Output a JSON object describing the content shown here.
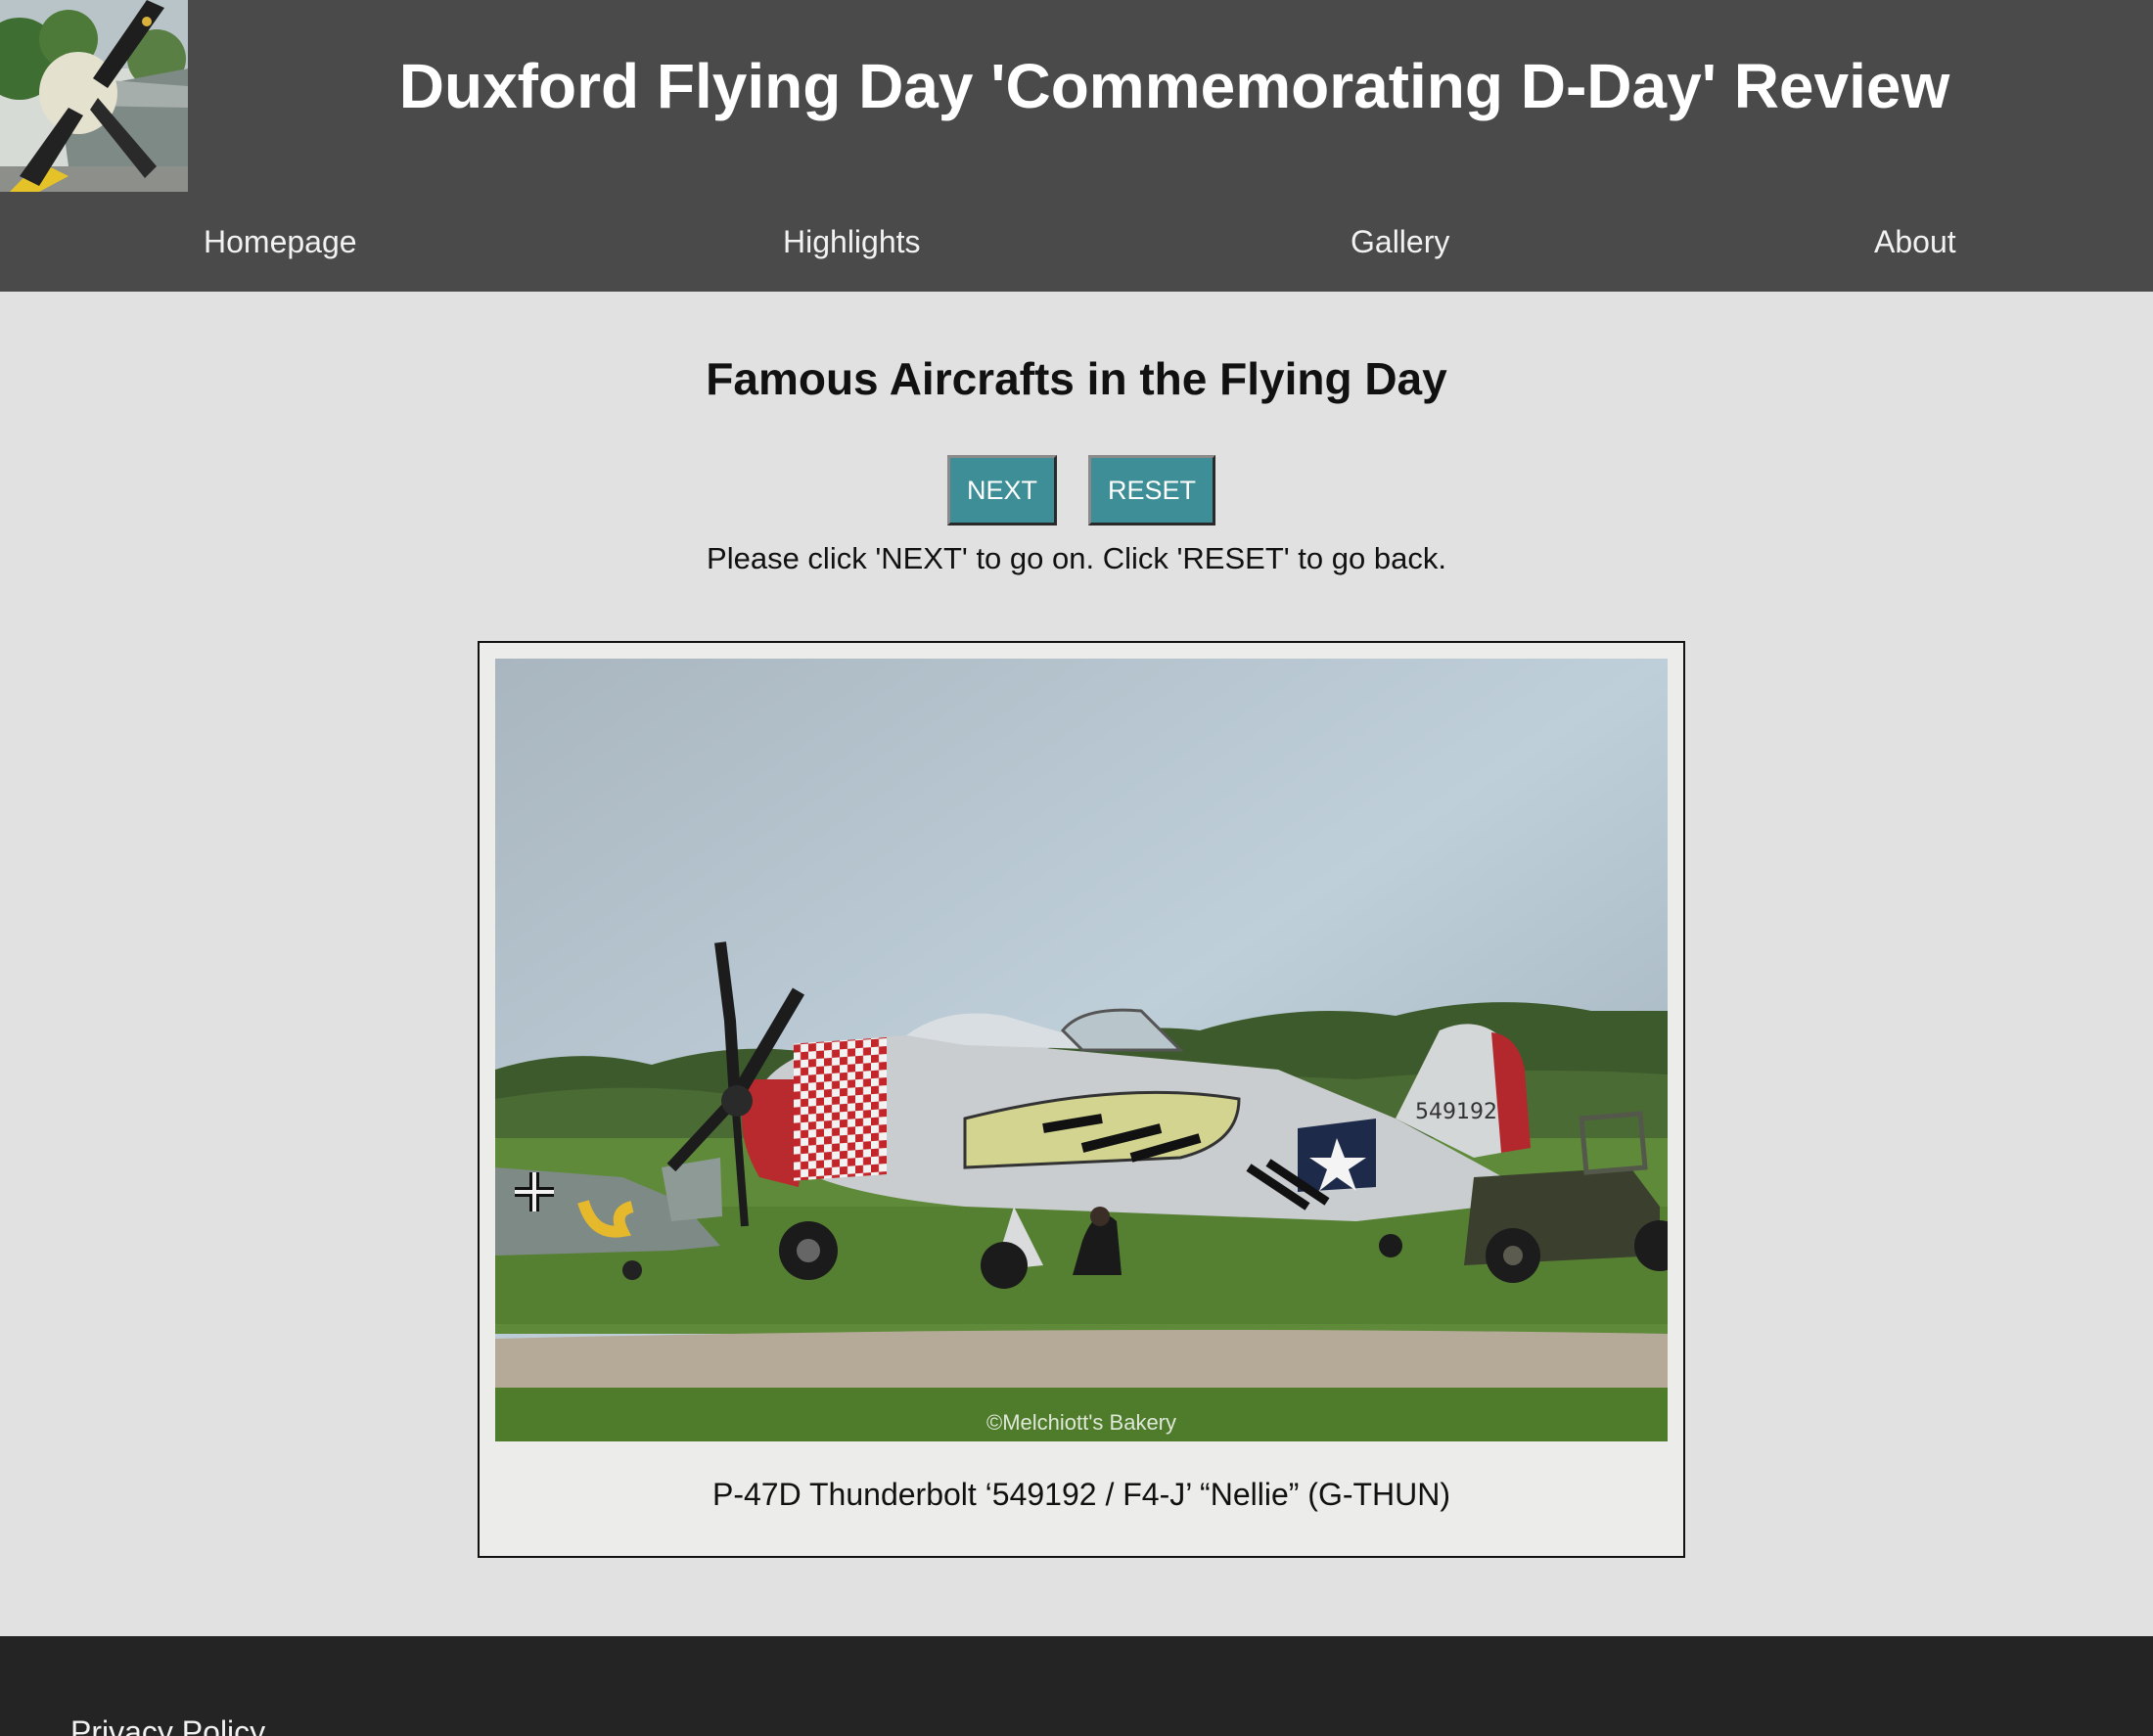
{
  "header": {
    "title": "Duxford Flying Day 'Commemorating D-Day' Review",
    "logo_icon": "spitfire-propeller-photo"
  },
  "nav": {
    "items": [
      {
        "label": "Homepage"
      },
      {
        "label": "Highlights"
      },
      {
        "label": "Gallery"
      },
      {
        "label": "About"
      }
    ]
  },
  "main": {
    "heading": "Famous Aircrafts in the Flying Day",
    "next_label": "NEXT",
    "reset_label": "RESET",
    "instructions": "Please click 'NEXT' to go on. Click 'RESET' to go back."
  },
  "figure": {
    "watermark": "©Melchiott's Bakery",
    "caption": "P-47D Thunderbolt ‘549192 / F4-J’ “Nellie” (G-THUN)",
    "tail_number": "549192"
  },
  "footer": {
    "privacy_label": "Privacy Policy"
  },
  "colors": {
    "header_bg": "#4a4a4a",
    "page_bg": "#e0e1e0",
    "button_bg": "#3e8e97",
    "footer_bg": "#242424"
  }
}
